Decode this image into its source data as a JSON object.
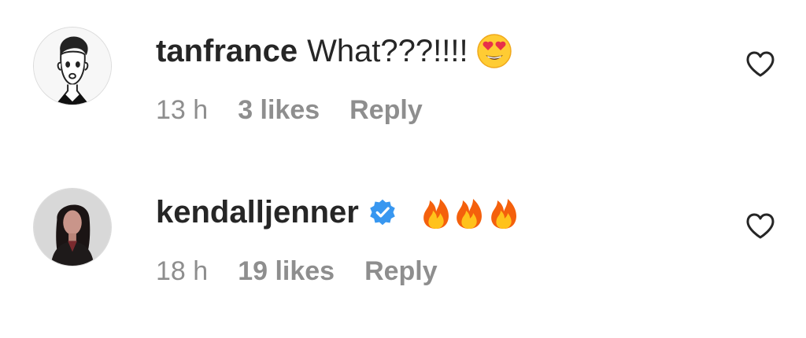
{
  "comments": [
    {
      "username": "tanfrance",
      "text": "What???!!!!",
      "emoji": "heart-eyes-emoji",
      "time": "13 h",
      "likes": "3 likes",
      "reply": "Reply",
      "verified": false
    },
    {
      "username": "kendalljenner",
      "text": "",
      "emoji": "fire-emoji x3",
      "time": "18 h",
      "likes": "19 likes",
      "reply": "Reply",
      "verified": true
    }
  ],
  "colors": {
    "primary_text": "#262626",
    "secondary_text": "#8e8e8e",
    "verified_blue": "#3897f0"
  }
}
